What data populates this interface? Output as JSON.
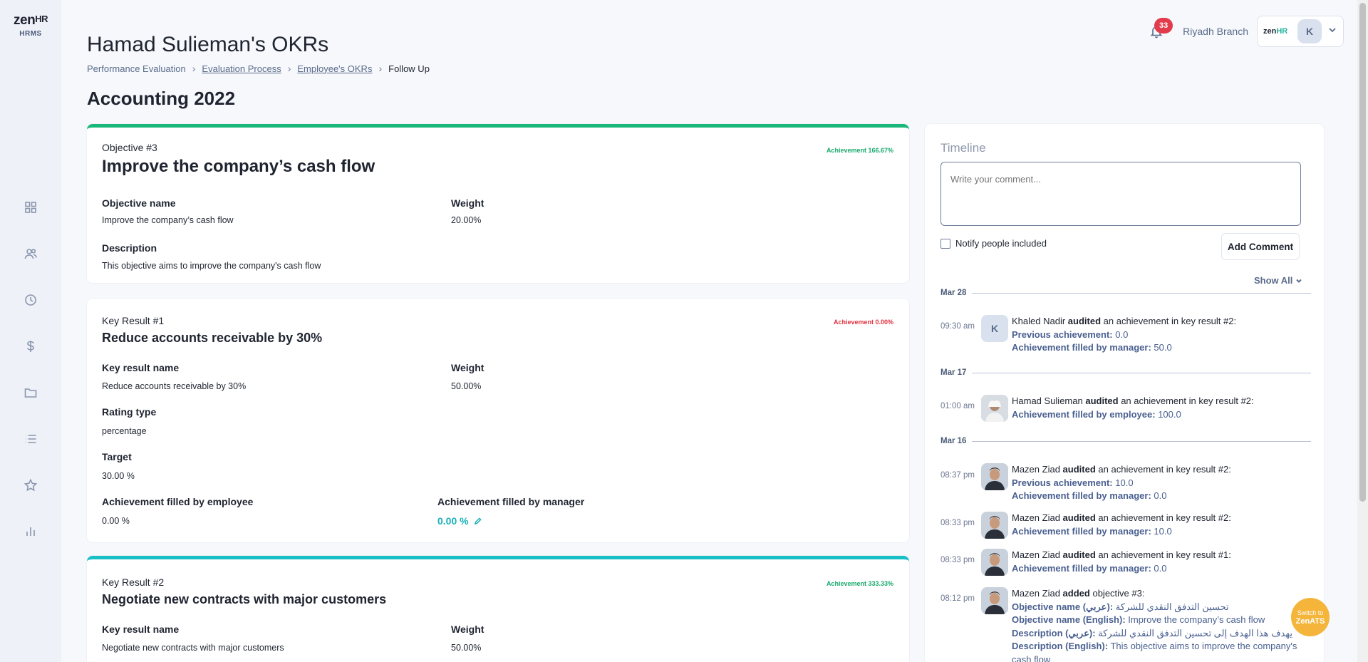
{
  "sidebar": {
    "logo_main": "zen",
    "logo_hr": "HR",
    "logo_sub": "HRMS",
    "items": [
      {
        "icon": "dashboard-icon"
      },
      {
        "icon": "users-icon"
      },
      {
        "icon": "clock-icon"
      },
      {
        "icon": "dollar-icon"
      },
      {
        "icon": "folder-icon"
      },
      {
        "icon": "list-icon"
      },
      {
        "icon": "star-icon"
      },
      {
        "icon": "bar-chart-icon"
      }
    ]
  },
  "header": {
    "title": "Hamad Sulieman's OKRs",
    "breadcrumb": {
      "item1": "Performance Evaluation",
      "item2": "Evaluation Process",
      "item3": "Employee's OKRs",
      "item4": "Follow Up"
    },
    "section_title": "Accounting 2022"
  },
  "topbar": {
    "notification_count": "33",
    "branch": "Riyadh Branch",
    "account_logo_main": "zen",
    "account_logo_hr": "HR",
    "account_initial": "K"
  },
  "objective": {
    "label": "Objective #3",
    "title": "Improve the company’s cash flow",
    "achievement": "Achievement 166.67%",
    "name_label": "Objective name",
    "name_value": "Improve the company’s cash flow",
    "weight_label": "Weight",
    "weight_value": "20.00%",
    "description_label": "Description",
    "description_value": "This objective aims to improve the company's cash flow"
  },
  "kr1": {
    "label": "Key Result #1",
    "title": "Reduce accounts receivable by 30%",
    "achievement": "Achievement 0.00%",
    "name_label": "Key result name",
    "name_value": "Reduce accounts receivable by 30%",
    "weight_label": "Weight",
    "weight_value": "50.00%",
    "rating_label": "Rating type",
    "rating_value": "percentage",
    "target_label": "Target",
    "target_value": "30.00 %",
    "emp_label": "Achievement filled by employee",
    "emp_value": "0.00 %",
    "mgr_label": "Achievement filled by manager",
    "mgr_value": "0.00 %"
  },
  "kr2": {
    "label": "Key Result #2",
    "title": "Negotiate new contracts with major customers",
    "achievement": "Achievement 333.33%",
    "name_label": "Key result name",
    "name_value": "Negotiate new contracts with major customers",
    "weight_label": "Weight",
    "weight_value": "50.00%"
  },
  "timeline": {
    "title": "Timeline",
    "comment_placeholder": "Write your comment...",
    "notify_label": "Notify people included",
    "add_button": "Add Comment",
    "show_all": "Show All",
    "dates": [
      "Mar 28",
      "Mar 17",
      "Mar 16"
    ],
    "entries": [
      {
        "time": "09:30 am",
        "avatar": "K",
        "user": "Khaled Nadir",
        "action": "audited",
        "rest": "an achievement in key result #2:",
        "l1k": "Previous achievement:",
        "l1v": "0.0",
        "l2k": "Achievement filled by manager:",
        "l2v": "50.0"
      },
      {
        "time": "01:00 am",
        "user": "Hamad Sulieman",
        "action": "audited",
        "rest": "an achievement in key result #2:",
        "l1k": "Achievement filled by employee:",
        "l1v": "100.0"
      },
      {
        "time": "08:37 pm",
        "user": "Mazen Ziad",
        "action": "audited",
        "rest": "an achievement in key result #2:",
        "l1k": "Previous achievement:",
        "l1v": "10.0",
        "l2k": "Achievement filled by manager:",
        "l2v": "0.0"
      },
      {
        "time": "08:33 pm",
        "user": "Mazen Ziad",
        "action": "audited",
        "rest": "an achievement in key result #2:",
        "l1k": "Achievement filled by manager:",
        "l1v": "10.0"
      },
      {
        "time": "08:33 pm",
        "user": "Mazen Ziad",
        "action": "audited",
        "rest": "an achievement in key result #1:",
        "l1k": "Achievement filled by manager:",
        "l1v": "0.0"
      },
      {
        "time": "08:12 pm",
        "user": "Mazen Ziad",
        "action": "added",
        "rest": "objective #3:",
        "l1k": "Objective name (عربي):",
        "l1v": "تحسين التدفق النقدي للشركة",
        "l2k": "Objective name (English):",
        "l2v": "Improve the company’s cash flow",
        "l3k": "Description (عربي):",
        "l3v": "يهدف هذا الهدف إلى تحسين التدفق النقدي للشركة",
        "l4k": "Description (English):",
        "l4v": "This objective aims to improve the company's cash flow"
      }
    ]
  },
  "zenats": {
    "line1": "Switch to",
    "line2": "ZenATS"
  },
  "colors": {
    "accent_green": "#19b87a",
    "accent_teal": "#19c0c8",
    "badge_red": "#e23b4b",
    "zenats_orange": "#f4b53a"
  }
}
